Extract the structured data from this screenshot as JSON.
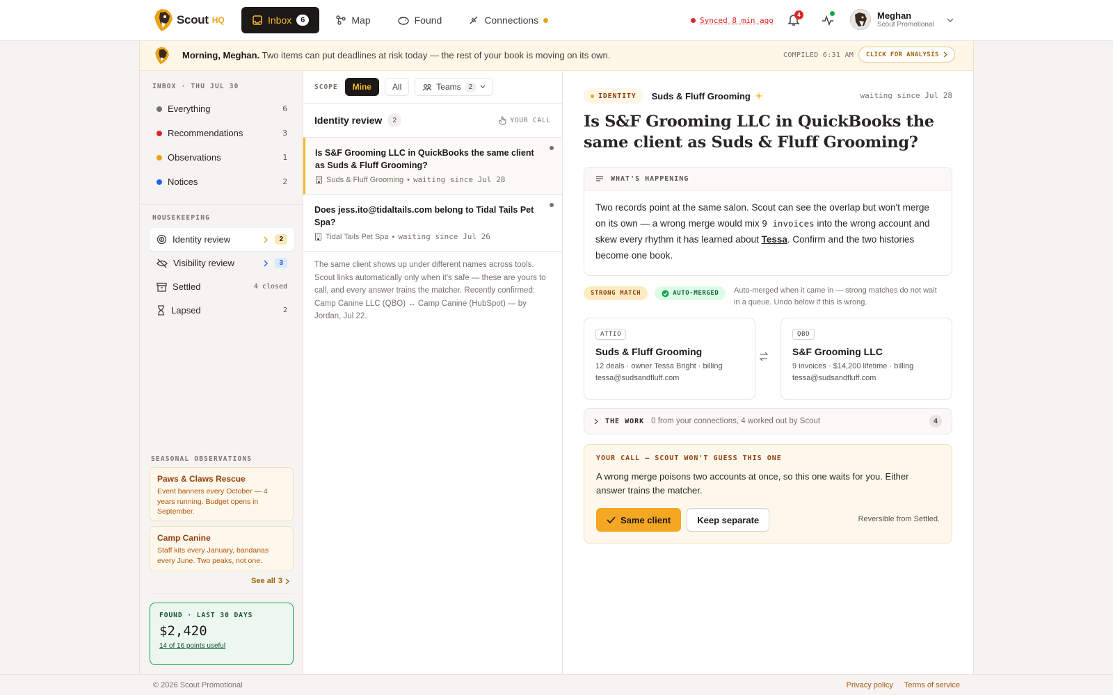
{
  "app": {
    "logo_text": "Scout",
    "logo_suffix": "HQ"
  },
  "nav": {
    "inbox": {
      "label": "Inbox",
      "count": "6"
    },
    "map": {
      "label": "Map"
    },
    "found": {
      "label": "Found"
    },
    "connections": {
      "label": "Connections"
    }
  },
  "status": {
    "synced": "Synced 8 min ago",
    "notifications": "4"
  },
  "user": {
    "name": "Meghan",
    "org": "Scout Promotional"
  },
  "banner": {
    "greeting": "Morning, Meghan.",
    "message": " Two items can put deadlines at risk today — the rest of your book is moving on its own.",
    "compiled": "COMPILED 6:31 AM",
    "analysis_button": "CLICK FOR ANALYSIS"
  },
  "inbox": {
    "label": "INBOX · THU JUL 30",
    "items": [
      {
        "label": "Everything",
        "count": "6",
        "color": "#78716c"
      },
      {
        "label": "Recommendations",
        "count": "3",
        "color": "#dc2626"
      },
      {
        "label": "Observations",
        "count": "1",
        "color": "#e8a317"
      },
      {
        "label": "Notices",
        "count": "2",
        "color": "#2563eb"
      }
    ]
  },
  "housekeeping": {
    "label": "HOUSEKEEPING",
    "identity": {
      "label": "Identity review",
      "count": "2"
    },
    "visibility": {
      "label": "Visibility review",
      "count": "3"
    },
    "settled": {
      "label": "Settled",
      "count": "4 closed"
    },
    "lapsed": {
      "label": "Lapsed",
      "count": "2"
    }
  },
  "seasonal": {
    "label": "SEASONAL OBSERVATIONS",
    "cards": [
      {
        "title": "Paws & Claws Rescue",
        "desc": "Event banners every October — 4 years running. Budget opens in September."
      },
      {
        "title": "Camp Canine",
        "desc": "Staff kits every January, bandanas every June. Two peaks, not one."
      }
    ],
    "see_all": "See all",
    "see_all_count": "3"
  },
  "found_card": {
    "label": "FOUND · LAST 30 DAYS",
    "value": "$2,420",
    "sub": "14 of 16 points useful"
  },
  "scope": {
    "label": "SCOPE",
    "mine": "Mine",
    "all": "All",
    "teams": "Teams",
    "teams_count": "2"
  },
  "list": {
    "title": "Identity review",
    "count": "2",
    "your_call": "YOUR CALL",
    "items": [
      {
        "question": "Is S&F Grooming LLC in QuickBooks the same client as Suds & Fluff Grooming?",
        "entity": "Suds & Fluff Grooming",
        "since": "waiting since Jul 28"
      },
      {
        "question": "Does jess.ito@tidaltails.com belong to Tidal Tails Pet Spa?",
        "entity": "Tidal Tails Pet Spa",
        "since": "waiting since Jul 26"
      }
    ],
    "description": "The same client shows up under different names across tools. Scout links automatically only when it's safe — these are yours to call, and every answer trains the matcher. Recently confirmed: Camp Canine LLC (QBO) ↔ Camp Canine (HubSpot) — by Jordan, Jul 22."
  },
  "detail": {
    "tag": "IDENTITY",
    "entity": "Suds & Fluff Grooming",
    "since": "waiting since Jul 28",
    "title_a": "Is ",
    "title_b": "S&F Grooming LLC",
    "title_c": " in QuickBooks the same client as ",
    "title_d": "Suds & Fluff Grooming",
    "title_e": "?",
    "happening_label": "WHAT'S HAPPENING",
    "happening_1": "Two records point at the same salon. Scout can see the overlap but won't merge on its own — a wrong merge would mix ",
    "happening_code": "9 invoices",
    "happening_2": " into the wrong account and skew every rhythm it has learned about ",
    "happening_name": "Tessa",
    "happening_3": ". Confirm and the two histories become one book.",
    "badge_match": "STRONG MATCH",
    "badge_merged": "AUTO-MERGED",
    "badge_note": "Auto-merged when it came in — strong matches do not wait in a queue. Undo below if this is wrong.",
    "record_a": {
      "source": "ATTIO",
      "name": "Suds & Fluff Grooming",
      "details": "12 deals · owner Tessa Bright · billing tessa@sudsandfluff.com"
    },
    "record_b": {
      "source": "QBO",
      "name": "S&F Grooming LLC",
      "details": "9 invoices · $14,200 lifetime · billing tessa@sudsandfluff.com"
    },
    "work_label": "THE WORK",
    "work_desc": "0 from your connections, 4 worked out by Scout",
    "work_count": "4",
    "call_label": "YOUR CALL — SCOUT WON'T GUESS THIS ONE",
    "call_desc": "A wrong merge poisons two accounts at once, so this one waits for you. Either answer trains the matcher.",
    "same_client": "Same client",
    "keep_separate": "Keep separate",
    "reversible": "Reversible from Settled."
  },
  "footer": {
    "copyright": "© 2026 Scout Promotional",
    "privacy": "Privacy policy",
    "terms": "Terms of service"
  }
}
